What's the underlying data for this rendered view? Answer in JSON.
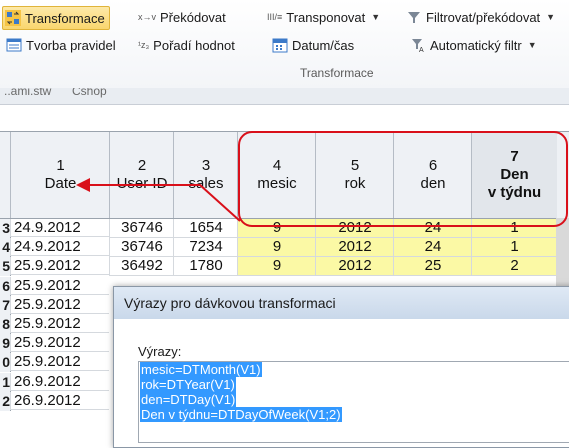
{
  "ribbon": {
    "row1": [
      {
        "icon": "transform-icon",
        "label": "Transformace",
        "active": true
      },
      {
        "icon": "recode-icon",
        "icon_glyph": "x→v",
        "label": "Překódovat"
      },
      {
        "icon": "transpose-icon",
        "icon_glyph": "III/≡",
        "label": "Transponovat",
        "dropdown": true
      },
      {
        "icon": "filter-icon",
        "label": "Filtrovat/překódovat",
        "dropdown": true
      }
    ],
    "row2": [
      {
        "icon": "rule-icon",
        "label": "Tvorba pravidel"
      },
      {
        "icon": "value-order-icon",
        "icon_glyph": "¹z₃",
        "label": "Pořadí hodnot"
      },
      {
        "icon": "calendar-icon",
        "label": "Datum/čas"
      },
      {
        "icon": "autofilter-icon",
        "label": "Automatický filtr",
        "dropdown": true
      }
    ],
    "group_label": "Transformace"
  },
  "tabs": [
    "..ami.stw",
    "Cshop"
  ],
  "columns": [
    {
      "num": "1",
      "name": "Date"
    },
    {
      "num": "2",
      "name": "User ID"
    },
    {
      "num": "3",
      "name": "sales"
    },
    {
      "num": "4",
      "name": "mesic"
    },
    {
      "num": "5",
      "name": "rok"
    },
    {
      "num": "6",
      "name": "den"
    },
    {
      "num": "7",
      "name_line1": "Den",
      "name_line2": "v týdnu"
    }
  ],
  "rows": [
    {
      "rh": "3",
      "date": "24.9.2012",
      "uid": "36746",
      "sales": "1654",
      "mesic": "9",
      "rok": "2012",
      "den": "24",
      "dow": "1"
    },
    {
      "rh": "4",
      "date": "24.9.2012",
      "uid": "36746",
      "sales": "7234",
      "mesic": "9",
      "rok": "2012",
      "den": "24",
      "dow": "1"
    },
    {
      "rh": "5",
      "date": "25.9.2012",
      "uid": "36492",
      "sales": "1780",
      "mesic": "9",
      "rok": "2012",
      "den": "25",
      "dow": "2"
    },
    {
      "rh": "6",
      "date": "25.9.2012"
    },
    {
      "rh": "7",
      "date": "25.9.2012"
    },
    {
      "rh": "8",
      "date": "25.9.2012"
    },
    {
      "rh": "9",
      "date": "25.9.2012"
    },
    {
      "rh": "0",
      "date": "25.9.2012"
    },
    {
      "rh": "1",
      "date": "26.9.2012"
    },
    {
      "rh": "2",
      "date": "26.9.2012"
    }
  ],
  "dialog": {
    "title": "Výrazy pro dávkovou transformaci",
    "label": "Výrazy:",
    "lines": [
      "mesic=DTMonth(V1)",
      "rok=DTYear(V1)",
      "den=DTDay(V1)",
      "Den v týdnu=DTDayOfWeek(V1;2)"
    ]
  },
  "colors": {
    "highlight": "#fbf9a5",
    "annotation": "#d9101a",
    "selection": "#3399ff",
    "active_button": "#f9d66e"
  }
}
